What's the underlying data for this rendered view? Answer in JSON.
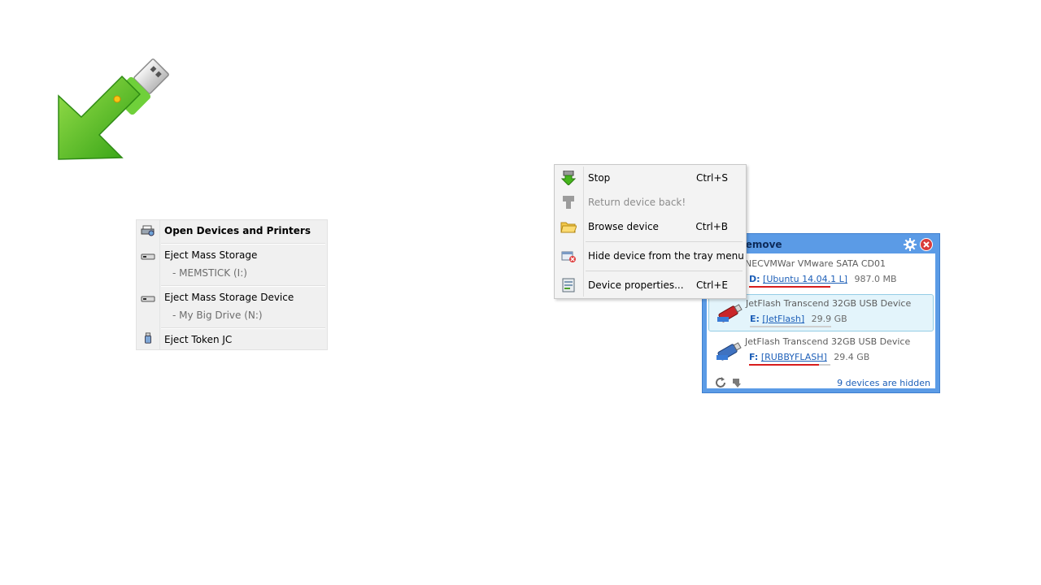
{
  "eject_menu": {
    "items": [
      {
        "label": "Open Devices and Printers",
        "icon": "printer-icon",
        "bold": true
      },
      {
        "label": "Eject Mass Storage",
        "icon": "drive-icon",
        "sub": "-   MEMSTICK (I:)"
      },
      {
        "label": "Eject Mass Storage Device",
        "icon": "drive-icon",
        "sub": "-   My Big Drive (N:)"
      },
      {
        "label": "Eject Token JC",
        "icon": "token-icon"
      }
    ]
  },
  "context_menu": {
    "items": [
      {
        "label": "Stop",
        "shortcut": "Ctrl+S",
        "icon": "stop-arrow-icon",
        "enabled": true
      },
      {
        "label": "Return device back!",
        "shortcut": "",
        "icon": "return-device-icon",
        "enabled": false
      },
      {
        "label": "Browse device",
        "shortcut": "Ctrl+B",
        "icon": "folder-icon",
        "enabled": true
      },
      {
        "label": "Hide device from the tray menu",
        "shortcut": "",
        "icon": "hide-device-icon",
        "enabled": true
      },
      {
        "label": "Device properties...",
        "shortcut": "Ctrl+E",
        "icon": "properties-icon",
        "enabled": true
      }
    ]
  },
  "panel": {
    "title": "fely Remove",
    "hidden_text": "9 devices are hidden",
    "devices": [
      {
        "name": "NECVMWar VMware SATA CD01",
        "letter": "D:",
        "volume": "[Ubuntu 14.04.1 L]",
        "size": "987.0 MB",
        "fill": 1.0,
        "fill_color": "#d81c1c"
      },
      {
        "name": "JetFlash Transcend 32GB USB Device",
        "letter": "E:",
        "volume": "[JetFlash]",
        "size": "29.9 GB",
        "fill": 0.0,
        "fill_color": "#d81c1c",
        "selected": true
      },
      {
        "name": "JetFlash Transcend 32GB USB Device",
        "letter": "F:",
        "volume": "[RUBBYFLASH]",
        "size": "29.4 GB",
        "fill": 0.86,
        "fill_color": "#d81c1c"
      }
    ]
  },
  "colors": {
    "panel_frame": "#5b9be6",
    "accent_red": "#d81c1c",
    "logo_green": "#3cb81c"
  }
}
